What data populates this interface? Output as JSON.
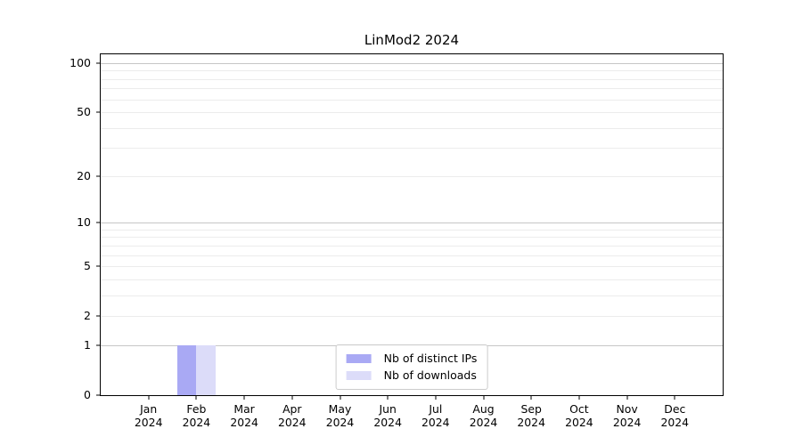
{
  "chart_data": {
    "type": "bar",
    "title": "LinMod2 2024",
    "yscale": "log1p",
    "ylim": [
      0,
      112.9
    ],
    "yticks": [
      0,
      1,
      2,
      5,
      10,
      20,
      50,
      100
    ],
    "grid_major": [
      1,
      10,
      100
    ],
    "grid_minor": [
      2,
      3,
      4,
      5,
      6,
      7,
      8,
      9,
      20,
      30,
      40,
      50,
      60,
      70,
      80,
      90
    ],
    "grid": "both",
    "legend_position": "lower center",
    "x_labels": [
      {
        "month": "Jan",
        "year": "2024"
      },
      {
        "month": "Feb",
        "year": "2024"
      },
      {
        "month": "Mar",
        "year": "2024"
      },
      {
        "month": "Apr",
        "year": "2024"
      },
      {
        "month": "May",
        "year": "2024"
      },
      {
        "month": "Jun",
        "year": "2024"
      },
      {
        "month": "Jul",
        "year": "2024"
      },
      {
        "month": "Aug",
        "year": "2024"
      },
      {
        "month": "Sep",
        "year": "2024"
      },
      {
        "month": "Oct",
        "year": "2024"
      },
      {
        "month": "Nov",
        "year": "2024"
      },
      {
        "month": "Dec",
        "year": "2024"
      }
    ],
    "series": [
      {
        "name": "Nb of distinct IPs",
        "color": "#a9a9f4",
        "values": [
          0,
          1,
          0,
          0,
          0,
          0,
          0,
          0,
          0,
          0,
          0,
          0
        ]
      },
      {
        "name": "Nb of downloads",
        "color": "#dcdcf9",
        "values": [
          0,
          1,
          0,
          0,
          0,
          0,
          0,
          0,
          0,
          0,
          0,
          0
        ]
      }
    ],
    "colors": {
      "grid_major": "#c6c6c6",
      "grid_minor": "#ececec",
      "spine": "#000000",
      "text": "#000000",
      "legend_border": "#cccccc",
      "background": "#ffffff"
    }
  }
}
